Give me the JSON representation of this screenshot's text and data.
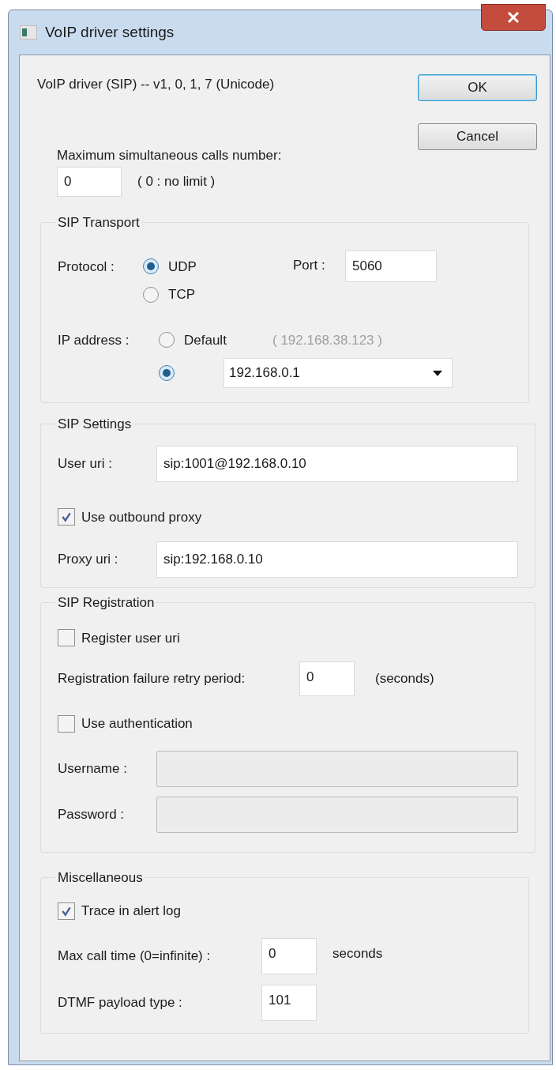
{
  "window": {
    "title": "VoIP driver settings"
  },
  "version_text": "VoIP driver (SIP) -- v1, 0, 1, 7 (Unicode)",
  "buttons": [
    {
      "label": "OK",
      "default": true
    },
    {
      "label": "Cancel",
      "default": false
    }
  ],
  "max_calls": {
    "label": "Maximum simultaneous calls number:",
    "value": "0",
    "hint": "( 0 : no limit )"
  },
  "sip_transport": {
    "title": "SIP Transport",
    "protocol_label": "Protocol :",
    "protocols": [
      {
        "label": "UDP",
        "selected": true
      },
      {
        "label": "TCP",
        "selected": false
      }
    ],
    "port_label": "Port :",
    "port": "5060",
    "ip_label": "IP address :",
    "ip_options": [
      {
        "kind": "default",
        "label": "Default",
        "hint": "( 192.168.38.123 )",
        "selected": false
      },
      {
        "kind": "custom",
        "value": "192.168.0.1",
        "selected": true
      }
    ]
  },
  "sip_settings": {
    "title": "SIP Settings",
    "user_uri_label": "User uri :",
    "user_uri": "sip:1001@192.168.0.10",
    "outbound_proxy": {
      "label": "Use outbound proxy",
      "checked": true
    },
    "proxy_uri_label": "Proxy uri :",
    "proxy_uri": "sip:192.168.0.10"
  },
  "sip_registration": {
    "title": "SIP Registration",
    "register": {
      "label": "Register user uri",
      "checked": false
    },
    "retry_label": "Registration failure retry period:",
    "retry_value": "0",
    "retry_unit": "(seconds)",
    "authentication": {
      "label": "Use authentication",
      "checked": false
    },
    "credentials": [
      {
        "label": "Username :",
        "disabled": true
      },
      {
        "label": "Password :",
        "disabled": true
      }
    ]
  },
  "miscellaneous": {
    "title": "Miscellaneous",
    "trace": {
      "label": "Trace in alert log",
      "checked": true
    },
    "max_call_time_label": "Max call time (0=infinite) :",
    "max_call_time": "0",
    "max_call_time_unit": "seconds",
    "dtmf_label": "DTMF payload type :",
    "dtmf": "101"
  }
}
